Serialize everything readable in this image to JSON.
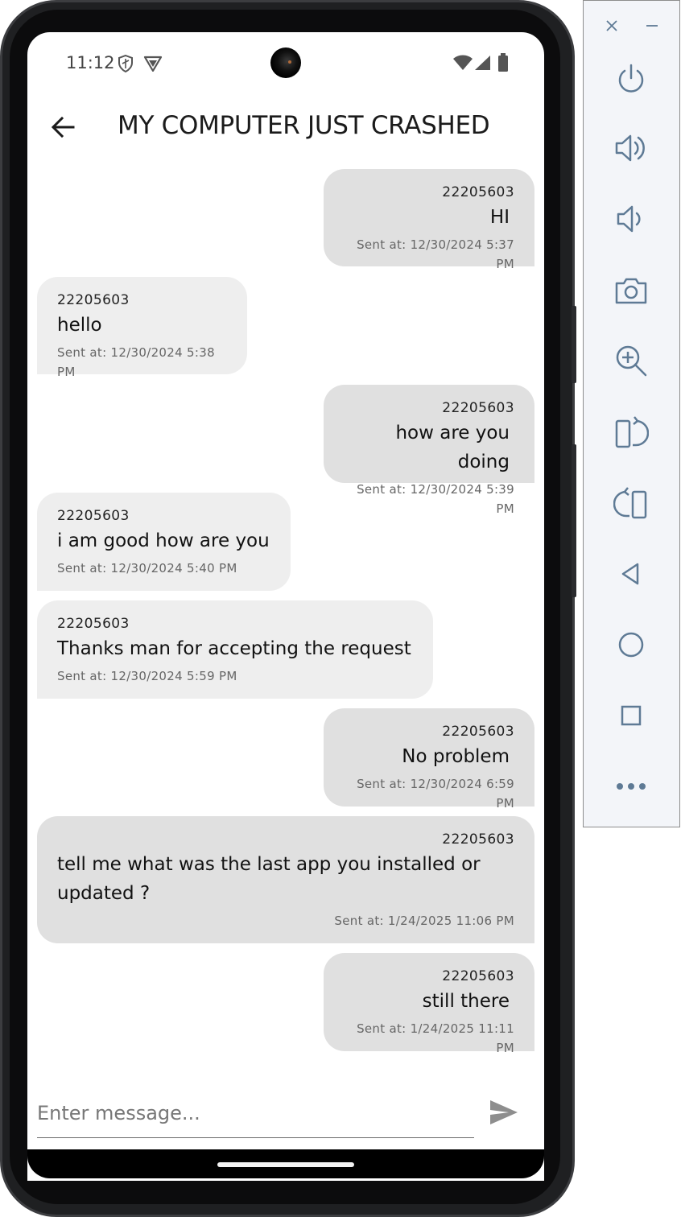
{
  "status_bar": {
    "time": "11:12"
  },
  "app_bar": {
    "title": "MY COMPUTER JUST CRASHED",
    "back_icon": "arrow-left-icon"
  },
  "messages": [
    {
      "direction": "sent",
      "sender": "22205603",
      "text": "HI",
      "timestamp": "Sent at: 12/30/2024 5:37 PM"
    },
    {
      "direction": "received",
      "sender": "22205603",
      "text": "hello",
      "timestamp": "Sent at: 12/30/2024 5:38 PM"
    },
    {
      "direction": "sent",
      "sender": "22205603",
      "text": "how are you doing",
      "timestamp": "Sent at: 12/30/2024 5:39 PM"
    },
    {
      "direction": "received",
      "sender": "22205603",
      "text": "i am good how are you",
      "timestamp": "Sent at: 12/30/2024 5:40 PM"
    },
    {
      "direction": "received",
      "sender": "22205603",
      "text": "Thanks man for accepting the request",
      "timestamp": "Sent at: 12/30/2024 5:59 PM"
    },
    {
      "direction": "sent",
      "sender": "22205603",
      "text": "No problem",
      "timestamp": "Sent at: 12/30/2024 6:59 PM"
    },
    {
      "direction": "received",
      "sender": "22205603",
      "text": "tell me what was the last app you installed or updated ?",
      "timestamp": "Sent at: 1/24/2025 11:06 PM"
    },
    {
      "direction": "sent",
      "sender": "22205603",
      "text": "still there",
      "timestamp": "Sent at: 1/24/2025 11:11 PM"
    }
  ],
  "composer": {
    "placeholder": "Enter message...",
    "value": "",
    "send_icon": "send-icon"
  },
  "colors": {
    "sent_bubble": "#e0e0e0",
    "received_bubble": "#eeeeee",
    "emulator_icon": "#5e7a95"
  },
  "emulator_toolbar": {
    "icons": [
      "close-icon",
      "minimize-icon",
      "power-icon",
      "volume-up-icon",
      "volume-down-icon",
      "camera-icon",
      "zoom-in-icon",
      "rotate-left-icon",
      "rotate-right-icon",
      "back-icon",
      "home-icon",
      "overview-icon",
      "more-icon"
    ]
  }
}
